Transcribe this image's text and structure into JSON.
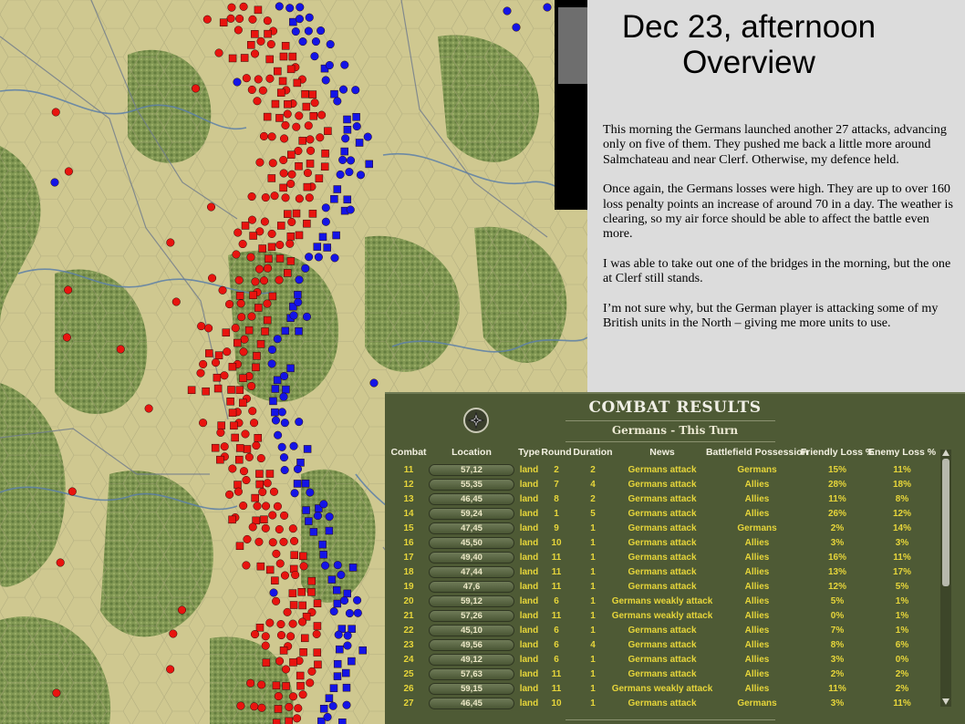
{
  "report": {
    "title_line1": "Dec 23, afternoon",
    "title_line2": "Overview",
    "paragraphs": [
      "This morning the Germans launched another 27 attacks, advancing only on five of them.  They pushed me back a little more around Salmchateau and near Clerf.  Otherwise, my defence held.",
      "Once again, the Germans losses were high.  They are up to over 160 loss penalty points an increase of around 70 in a day.  The weather is clearing, so my air force should be able to affect the battle even more.",
      "I was able to take out one of the bridges in the morning, but the one at Clerf still stands.",
      "I’m not sure why, but the German player is attacking some of my British units in the North – giving me more units to use."
    ]
  },
  "combat_results": {
    "title": "COMBAT RESULTS",
    "subtitle": "Germans - This Turn",
    "emblem_icon": "iron-cross-icon",
    "headers": {
      "combat": "Combat",
      "location": "Location",
      "type": "Type",
      "round": "Round",
      "duration": "Duration",
      "news": "News",
      "possession": "Battlefield Possession",
      "friendly_loss": "Friendly Loss %",
      "enemy_loss": "Enemy Loss %"
    },
    "rows": [
      {
        "combat": "11",
        "location": "57,12",
        "type": "land",
        "round": "2",
        "duration": "2",
        "news": "Germans attack",
        "possession": "Germans",
        "friendly": "15%",
        "enemy": "11%"
      },
      {
        "combat": "12",
        "location": "55,35",
        "type": "land",
        "round": "7",
        "duration": "4",
        "news": "Germans attack",
        "possession": "Allies",
        "friendly": "28%",
        "enemy": "18%"
      },
      {
        "combat": "13",
        "location": "46,45",
        "type": "land",
        "round": "8",
        "duration": "2",
        "news": "Germans attack",
        "possession": "Allies",
        "friendly": "11%",
        "enemy": "8%"
      },
      {
        "combat": "14",
        "location": "59,24",
        "type": "land",
        "round": "1",
        "duration": "5",
        "news": "Germans attack",
        "possession": "Allies",
        "friendly": "26%",
        "enemy": "12%"
      },
      {
        "combat": "15",
        "location": "47,45",
        "type": "land",
        "round": "9",
        "duration": "1",
        "news": "Germans attack",
        "possession": "Germans",
        "friendly": "2%",
        "enemy": "14%"
      },
      {
        "combat": "16",
        "location": "45,50",
        "type": "land",
        "round": "10",
        "duration": "1",
        "news": "Germans attack",
        "possession": "Allies",
        "friendly": "3%",
        "enemy": "3%"
      },
      {
        "combat": "17",
        "location": "49,40",
        "type": "land",
        "round": "11",
        "duration": "1",
        "news": "Germans attack",
        "possession": "Allies",
        "friendly": "16%",
        "enemy": "11%"
      },
      {
        "combat": "18",
        "location": "47,44",
        "type": "land",
        "round": "11",
        "duration": "1",
        "news": "Germans attack",
        "possession": "Allies",
        "friendly": "13%",
        "enemy": "17%"
      },
      {
        "combat": "19",
        "location": "47,6",
        "type": "land",
        "round": "11",
        "duration": "1",
        "news": "Germans attack",
        "possession": "Allies",
        "friendly": "12%",
        "enemy": "5%"
      },
      {
        "combat": "20",
        "location": "59,12",
        "type": "land",
        "round": "6",
        "duration": "1",
        "news": "Germans weakly attack",
        "possession": "Allies",
        "friendly": "5%",
        "enemy": "1%"
      },
      {
        "combat": "21",
        "location": "57,26",
        "type": "land",
        "round": "11",
        "duration": "1",
        "news": "Germans weakly attack",
        "possession": "Allies",
        "friendly": "0%",
        "enemy": "1%"
      },
      {
        "combat": "22",
        "location": "45,10",
        "type": "land",
        "round": "6",
        "duration": "1",
        "news": "Germans attack",
        "possession": "Allies",
        "friendly": "7%",
        "enemy": "1%"
      },
      {
        "combat": "23",
        "location": "49,56",
        "type": "land",
        "round": "6",
        "duration": "4",
        "news": "Germans attack",
        "possession": "Allies",
        "friendly": "8%",
        "enemy": "6%"
      },
      {
        "combat": "24",
        "location": "49,12",
        "type": "land",
        "round": "6",
        "duration": "1",
        "news": "Germans attack",
        "possession": "Allies",
        "friendly": "3%",
        "enemy": "0%"
      },
      {
        "combat": "25",
        "location": "57,63",
        "type": "land",
        "round": "11",
        "duration": "1",
        "news": "Germans attack",
        "possession": "Allies",
        "friendly": "2%",
        "enemy": "2%"
      },
      {
        "combat": "26",
        "location": "59,15",
        "type": "land",
        "round": "11",
        "duration": "1",
        "news": "Germans weakly attack",
        "possession": "Allies",
        "friendly": "11%",
        "enemy": "2%"
      },
      {
        "combat": "27",
        "location": "46,45",
        "type": "land",
        "round": "10",
        "duration": "1",
        "news": "Germans attack",
        "possession": "Germans",
        "friendly": "3%",
        "enemy": "11%"
      }
    ]
  },
  "colors": {
    "german_units": "#e8140f",
    "allied_units": "#1414e6",
    "panel_bg": "#4e5a35",
    "value_text": "#e6d53a",
    "terrain_clear": "#cfc890",
    "terrain_forest": "#7d9350"
  }
}
